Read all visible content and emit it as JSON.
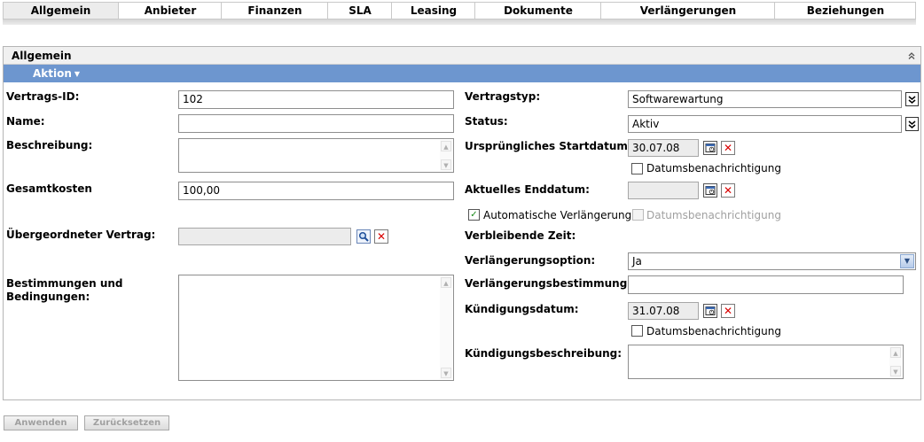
{
  "tabs": [
    {
      "label": "Allgemein"
    },
    {
      "label": "Anbieter"
    },
    {
      "label": "Finanzen"
    },
    {
      "label": "SLA"
    },
    {
      "label": "Leasing"
    },
    {
      "label": "Dokumente"
    },
    {
      "label": "Verlängerungen"
    },
    {
      "label": "Beziehungen"
    }
  ],
  "panel": {
    "title": "Allgemein",
    "action_label": "Aktion"
  },
  "left": {
    "contract_id_label": "Vertrags-ID:",
    "contract_id_value": "102",
    "name_label": "Name:",
    "name_value": "",
    "description_label": "Beschreibung:",
    "total_cost_label": "Gesamtkosten",
    "total_cost_value": "100,00",
    "parent_contract_label": "Übergeordneter Vertrag:",
    "parent_contract_value": "",
    "terms_label": "Bestimmungen und Bedingungen:"
  },
  "right": {
    "contract_type_label": "Vertragstyp:",
    "contract_type_value": "Softwarewartung",
    "status_label": "Status:",
    "status_value": "Aktiv",
    "orig_start_label": "Ursprüngliches Startdatum:",
    "orig_start_value": "30.07.08",
    "date_notify_label": "Datumsbenachrichtigung",
    "current_end_label": "Aktuelles Enddatum:",
    "current_end_value": "",
    "auto_renew_label": "Automatische Verlängerung",
    "remaining_time_label": "Verbleibende Zeit:",
    "renewal_option_label": "Verlängerungsoption:",
    "renewal_option_value": "Ja",
    "renewal_terms_label": "Verlängerungsbestimmung:",
    "renewal_terms_value": "",
    "cancel_date_label": "Kündigungsdatum:",
    "cancel_date_value": "31.07.08",
    "cancel_desc_label": "Kündigungsbeschreibung:"
  },
  "footer": {
    "apply_label": "Anwenden",
    "reset_label": "Zurücksetzen"
  },
  "colors": {
    "action_bar": "#6d96cf",
    "active_tab": "#ececec",
    "clear_icon": "#d90000"
  }
}
